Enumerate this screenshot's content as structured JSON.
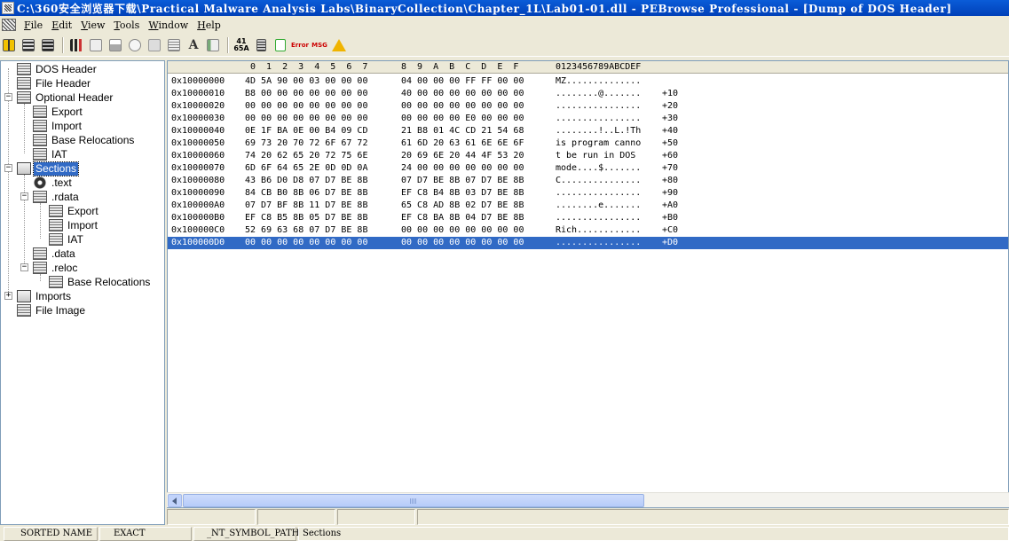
{
  "window": {
    "title": "C:\\360安全浏览器下载\\Practical Malware Analysis Labs\\BinaryCollection\\Chapter_1L\\Lab01-01.dll - PEBrowse Professional - [Dump of DOS Header]"
  },
  "menu": {
    "file": "File",
    "edit": "Edit",
    "view": "View",
    "tools": "Tools",
    "window": "Window",
    "help": "Help"
  },
  "toolbar": {
    "hex_label_top": "41",
    "hex_label_bottom": "65A",
    "error_label": "Error",
    "msg_label": "MSG"
  },
  "tree": {
    "dos_header": "DOS Header",
    "file_header": "File Header",
    "optional_header": "Optional Header",
    "oh_export": "Export",
    "oh_import": "Import",
    "oh_base_relocations": "Base Relocations",
    "oh_iat": "IAT",
    "sections": "Sections",
    "text": ".text",
    "rdata": ".rdata",
    "rdata_export": "Export",
    "rdata_import": "Import",
    "rdata_iat": "IAT",
    "data": ".data",
    "reloc": ".reloc",
    "reloc_base_relocations": "Base Relocations",
    "imports": "Imports",
    "file_image": "File Image"
  },
  "hex": {
    "header": {
      "cols1": "0  1  2  3  4  5  6  7",
      "cols2": "8  9  A  B  C  D  E  F",
      "ascii": "0123456789ABCDEF"
    },
    "rows": [
      {
        "addr": "0x10000000",
        "h1": "4D 5A 90 00 03 00 00 00",
        "h2": "04 00 00 00 FF FF 00 00",
        "ascii": "MZ..............",
        "off": ""
      },
      {
        "addr": "0x10000010",
        "h1": "B8 00 00 00 00 00 00 00",
        "h2": "40 00 00 00 00 00 00 00",
        "ascii": "........@.......",
        "off": "+10"
      },
      {
        "addr": "0x10000020",
        "h1": "00 00 00 00 00 00 00 00",
        "h2": "00 00 00 00 00 00 00 00",
        "ascii": "................",
        "off": "+20"
      },
      {
        "addr": "0x10000030",
        "h1": "00 00 00 00 00 00 00 00",
        "h2": "00 00 00 00 E0 00 00 00",
        "ascii": "................",
        "off": "+30"
      },
      {
        "addr": "0x10000040",
        "h1": "0E 1F BA 0E 00 B4 09 CD",
        "h2": "21 B8 01 4C CD 21 54 68",
        "ascii": "........!..L.!Th",
        "off": "+40"
      },
      {
        "addr": "0x10000050",
        "h1": "69 73 20 70 72 6F 67 72",
        "h2": "61 6D 20 63 61 6E 6E 6F",
        "ascii": "is program canno",
        "off": "+50"
      },
      {
        "addr": "0x10000060",
        "h1": "74 20 62 65 20 72 75 6E",
        "h2": "20 69 6E 20 44 4F 53 20",
        "ascii": "t be run in DOS ",
        "off": "+60"
      },
      {
        "addr": "0x10000070",
        "h1": "6D 6F 64 65 2E 0D 0D 0A",
        "h2": "24 00 00 00 00 00 00 00",
        "ascii": "mode....$.......",
        "off": "+70"
      },
      {
        "addr": "0x10000080",
        "h1": "43 B6 D0 D8 07 D7 BE 8B",
        "h2": "07 D7 BE 8B 07 D7 BE 8B",
        "ascii": "C...............",
        "off": "+80"
      },
      {
        "addr": "0x10000090",
        "h1": "84 CB B0 8B 06 D7 BE 8B",
        "h2": "EF C8 B4 8B 03 D7 BE 8B",
        "ascii": "................",
        "off": "+90"
      },
      {
        "addr": "0x100000A0",
        "h1": "07 D7 BF 8B 11 D7 BE 8B",
        "h2": "65 C8 AD 8B 02 D7 BE 8B",
        "ascii": "........e.......",
        "off": "+A0"
      },
      {
        "addr": "0x100000B0",
        "h1": "EF C8 B5 8B 05 D7 BE 8B",
        "h2": "EF C8 BA 8B 04 D7 BE 8B",
        "ascii": "................",
        "off": "+B0"
      },
      {
        "addr": "0x100000C0",
        "h1": "52 69 63 68 07 D7 BE 8B",
        "h2": "00 00 00 00 00 00 00 00",
        "ascii": "Rich............",
        "off": "+C0"
      },
      {
        "addr": "0x100000D0",
        "h1": "00 00 00 00 00 00 00 00",
        "h2": "00 00 00 00 00 00 00 00",
        "ascii": "................",
        "off": "+D0"
      }
    ]
  },
  "status": {
    "sorted_name": "SORTED NAME",
    "exact_symbols": "EXACT SYMBOLS",
    "nt_symbol_path": "_NT_SYMBOL_PATH",
    "current": "Sections"
  }
}
